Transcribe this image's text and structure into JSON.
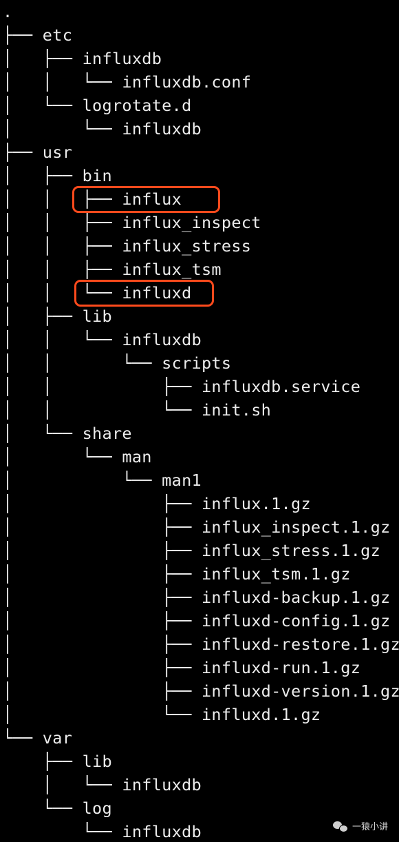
{
  "colors": {
    "background": "#000000",
    "text": "#ececec",
    "highlight": "#ff4a1c"
  },
  "tree": {
    "lines": [
      {
        "conn": "",
        "name": "."
      },
      {
        "conn": "├── ",
        "name": "etc"
      },
      {
        "conn": "│   ├── ",
        "name": "influxdb"
      },
      {
        "conn": "│   │   └── ",
        "name": "influxdb.conf"
      },
      {
        "conn": "│   └── ",
        "name": "logrotate.d"
      },
      {
        "conn": "│       └── ",
        "name": "influxdb"
      },
      {
        "conn": "├── ",
        "name": "usr"
      },
      {
        "conn": "│   ├── ",
        "name": "bin"
      },
      {
        "conn": "│   │   ├── ",
        "name": "influx"
      },
      {
        "conn": "│   │   ├── ",
        "name": "influx_inspect"
      },
      {
        "conn": "│   │   ├── ",
        "name": "influx_stress"
      },
      {
        "conn": "│   │   ├── ",
        "name": "influx_tsm"
      },
      {
        "conn": "│   │   └── ",
        "name": "influxd"
      },
      {
        "conn": "│   ├── ",
        "name": "lib"
      },
      {
        "conn": "│   │   └── ",
        "name": "influxdb"
      },
      {
        "conn": "│   │       └── ",
        "name": "scripts"
      },
      {
        "conn": "│   │           ├── ",
        "name": "influxdb.service"
      },
      {
        "conn": "│   │           └── ",
        "name": "init.sh"
      },
      {
        "conn": "│   └── ",
        "name": "share"
      },
      {
        "conn": "│       └── ",
        "name": "man"
      },
      {
        "conn": "│           └── ",
        "name": "man1"
      },
      {
        "conn": "│               ├── ",
        "name": "influx.1.gz"
      },
      {
        "conn": "│               ├── ",
        "name": "influx_inspect.1.gz"
      },
      {
        "conn": "│               ├── ",
        "name": "influx_stress.1.gz"
      },
      {
        "conn": "│               ├── ",
        "name": "influx_tsm.1.gz"
      },
      {
        "conn": "│               ├── ",
        "name": "influxd-backup.1.gz"
      },
      {
        "conn": "│               ├── ",
        "name": "influxd-config.1.gz"
      },
      {
        "conn": "│               ├── ",
        "name": "influxd-restore.1.gz"
      },
      {
        "conn": "│               ├── ",
        "name": "influxd-run.1.gz"
      },
      {
        "conn": "│               ├── ",
        "name": "influxd-version.1.gz"
      },
      {
        "conn": "│               └── ",
        "name": "influxd.1.gz"
      },
      {
        "conn": "└── ",
        "name": "var"
      },
      {
        "conn": "    ├── ",
        "name": "lib"
      },
      {
        "conn": "    │   └── ",
        "name": "influxdb"
      },
      {
        "conn": "    └── ",
        "name": "log"
      },
      {
        "conn": "        └── ",
        "name": "influxdb"
      }
    ],
    "highlighted_lines": [
      8,
      12
    ]
  },
  "watermark": {
    "icon": "wechat-icon",
    "text": "一猿小讲"
  }
}
